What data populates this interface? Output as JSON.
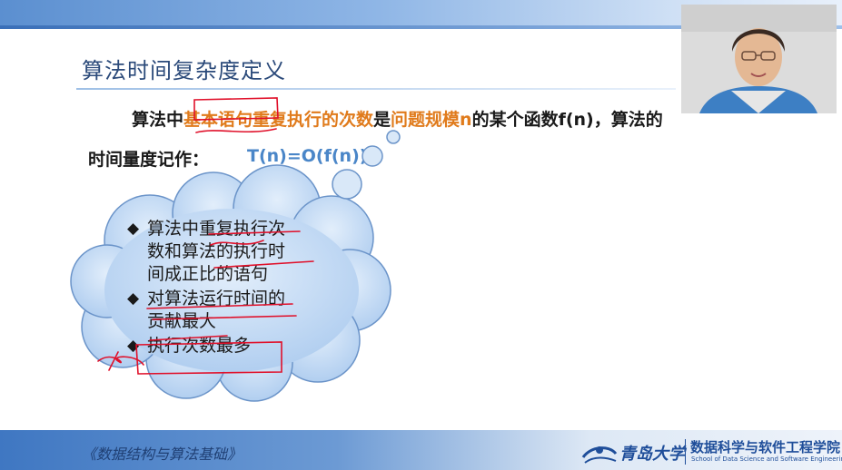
{
  "slide": {
    "title": "算法时间复杂度定义",
    "line1": {
      "part1": "算法中",
      "part2_highlight": "基本语句重复执行的次数",
      "part3": "是",
      "part4_highlight": "问题规模n",
      "part5": "的某个函数f(n)，算法的"
    },
    "line2_label": "时间量度记作：",
    "formula": "T(n)=O(f(n))",
    "bubble": {
      "items": [
        {
          "bullet": "◆",
          "lines": [
            "算法中重复执行次",
            "数和算法的执行时",
            "间成正比的语句"
          ]
        },
        {
          "bullet": "◆",
          "lines": [
            "对算法运行时间的",
            "贡献最大"
          ]
        },
        {
          "bullet": "◆",
          "lines": [
            "执行次数最多"
          ]
        }
      ]
    }
  },
  "footer": {
    "course": "《数据结构与算法基础》",
    "university": "青岛大学",
    "school_cn": "数据科学与软件工程学院",
    "school_en": "School of Data Science and Software Engineering"
  },
  "colors": {
    "highlight": "#e07b1c",
    "formula": "#4a86c8",
    "title": "#2b4a7a",
    "cloud_fill": "#bcd6f2",
    "annotation_ink": "#e0102a"
  },
  "webcam": {
    "label": "presenter-webcam"
  }
}
